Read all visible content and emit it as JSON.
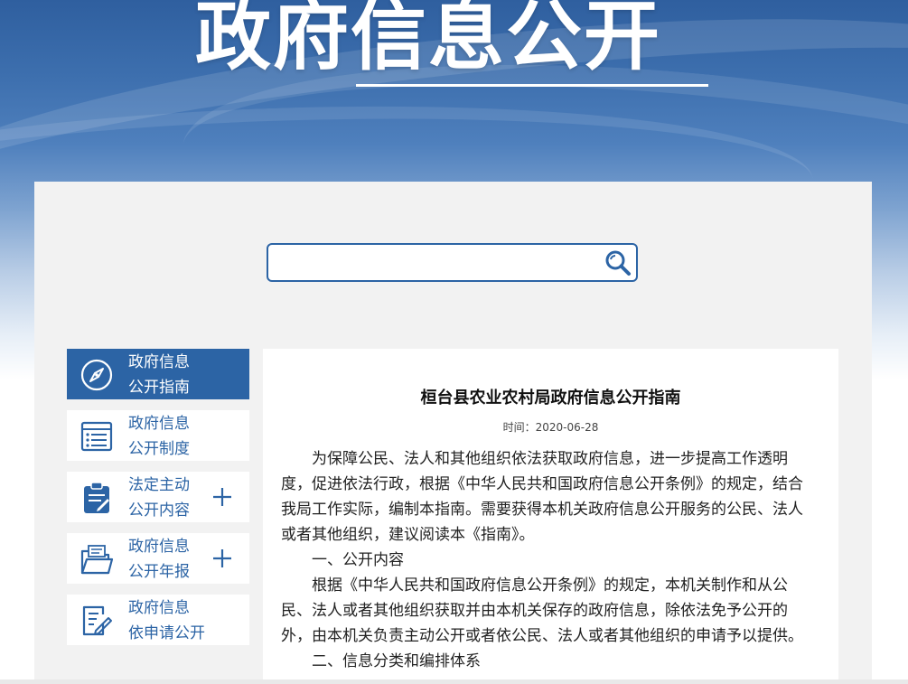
{
  "header": {
    "title": "政府信息公开"
  },
  "search": {
    "placeholder": "",
    "value": "",
    "icon": "search-icon"
  },
  "sidebar": {
    "items": [
      {
        "line1": "政府信息",
        "line2": "公开指南",
        "icon": "compass-icon",
        "active": true
      },
      {
        "line1": "政府信息",
        "line2": "公开制度",
        "icon": "list-icon",
        "active": false
      },
      {
        "line1": "法定主动",
        "line2": "公开内容",
        "icon": "clipboard-icon",
        "active": false,
        "expand": "plus-icon"
      },
      {
        "line1": "政府信息",
        "line2": "公开年报",
        "icon": "folder-icon",
        "active": false,
        "expand": "plus-icon"
      },
      {
        "line1": "政府信息",
        "line2": "依申请公开",
        "icon": "form-edit-icon",
        "active": false
      }
    ]
  },
  "article": {
    "title": "桓台县农业农村局政府信息公开指南",
    "meta": "时间：2020-06-28",
    "paragraphs": [
      "为保障公民、法人和其他组织依法获取政府信息，进一步提高工作透明度，促进依法行政，根据《中华人民共和国政府信息公开条例》的规定，结合我局工作实际，编制本指南。需要获得本机关政府信息公开服务的公民、法人或者其他组织，建议阅读本《指南》。",
      "一、公开内容",
      "根据《中华人民共和国政府信息公开条例》的规定，本机关制作和从公民、法人或者其他组织获取并由本机关保存的政府信息，除依法免予公开的外，由本机关负责主动公开或者依公民、法人或者其他组织的申请予以提供。",
      "二、信息分类和编排体系"
    ]
  },
  "colors": {
    "accent": "#2c64a5",
    "panel": "#f2f2f2"
  }
}
